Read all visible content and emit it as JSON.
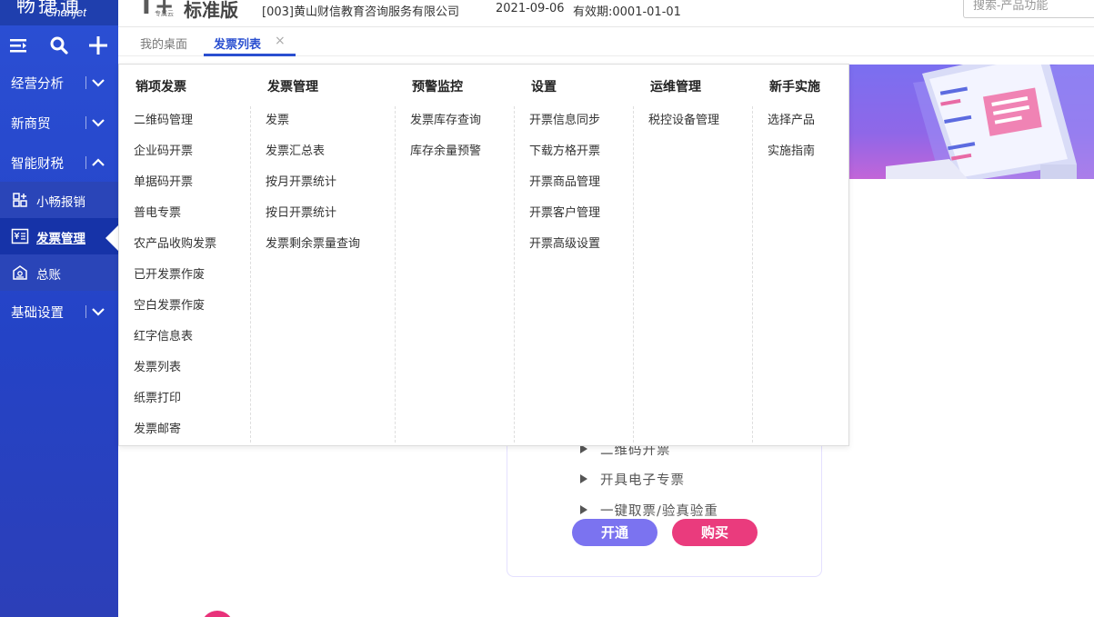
{
  "logo": {
    "main": "畅捷通",
    "sub": "Chanjet"
  },
  "header": {
    "brand_mark": "T+",
    "brand_small": "专属云",
    "brand_name": "标准版",
    "company": "[003]黄山财信教育咨询服务有限公司",
    "date": "2021-09-06",
    "validity": "有效期:0001-01-01",
    "search_placeholder": "搜索-产品功能"
  },
  "sidebar": {
    "tools": [
      "menu-icon",
      "search-icon",
      "plus-icon"
    ],
    "items": [
      {
        "label": "经营分析",
        "expanded": false
      },
      {
        "label": "新商贸",
        "expanded": false
      },
      {
        "label": "智能财税",
        "expanded": true
      },
      {
        "label": "基础设置",
        "expanded": false
      }
    ],
    "subitems": [
      {
        "label": "小畅报销",
        "icon": "expense-icon"
      },
      {
        "label": "发票管理",
        "icon": "invoice-icon",
        "active": true
      },
      {
        "label": "总账",
        "icon": "ledger-icon"
      }
    ]
  },
  "tabs": {
    "home": "我的桌面",
    "active": "发票列表",
    "close": "×"
  },
  "menu": {
    "columns": [
      {
        "title": "销项发票",
        "items": [
          "二维码管理",
          "企业码开票",
          "单据码开票",
          "普电专票",
          "农产品收购发票",
          "已开发票作废",
          "空白发票作废",
          "红字信息表",
          "发票列表",
          "纸票打印",
          "发票邮寄"
        ]
      },
      {
        "title": "发票管理",
        "items": [
          "发票",
          "发票汇总表",
          "按月开票统计",
          "按日开票统计",
          "发票剩余票量查询"
        ]
      },
      {
        "title": "预警监控",
        "items": [
          "发票库存查询",
          "库存余量预警"
        ]
      },
      {
        "title": "设置",
        "items": [
          "开票信息同步",
          "下载方格开票",
          "开票商品管理",
          "开票客户管理",
          "开票高级设置"
        ]
      },
      {
        "title": "运维管理",
        "items": [
          "税控设备管理"
        ]
      },
      {
        "title": "新手实施",
        "items": [
          "选择产品",
          "实施指南"
        ]
      }
    ]
  },
  "promo": {
    "features": [
      "二维码开票",
      "开具电子专票",
      "一键取票/验真验重"
    ],
    "open_label": "开通",
    "buy_label": "购买"
  },
  "colors": {
    "sidebar": "#2443c6",
    "accent": "#2a4fd0",
    "open": "#7b73f0",
    "buy": "#ea3b7d"
  }
}
